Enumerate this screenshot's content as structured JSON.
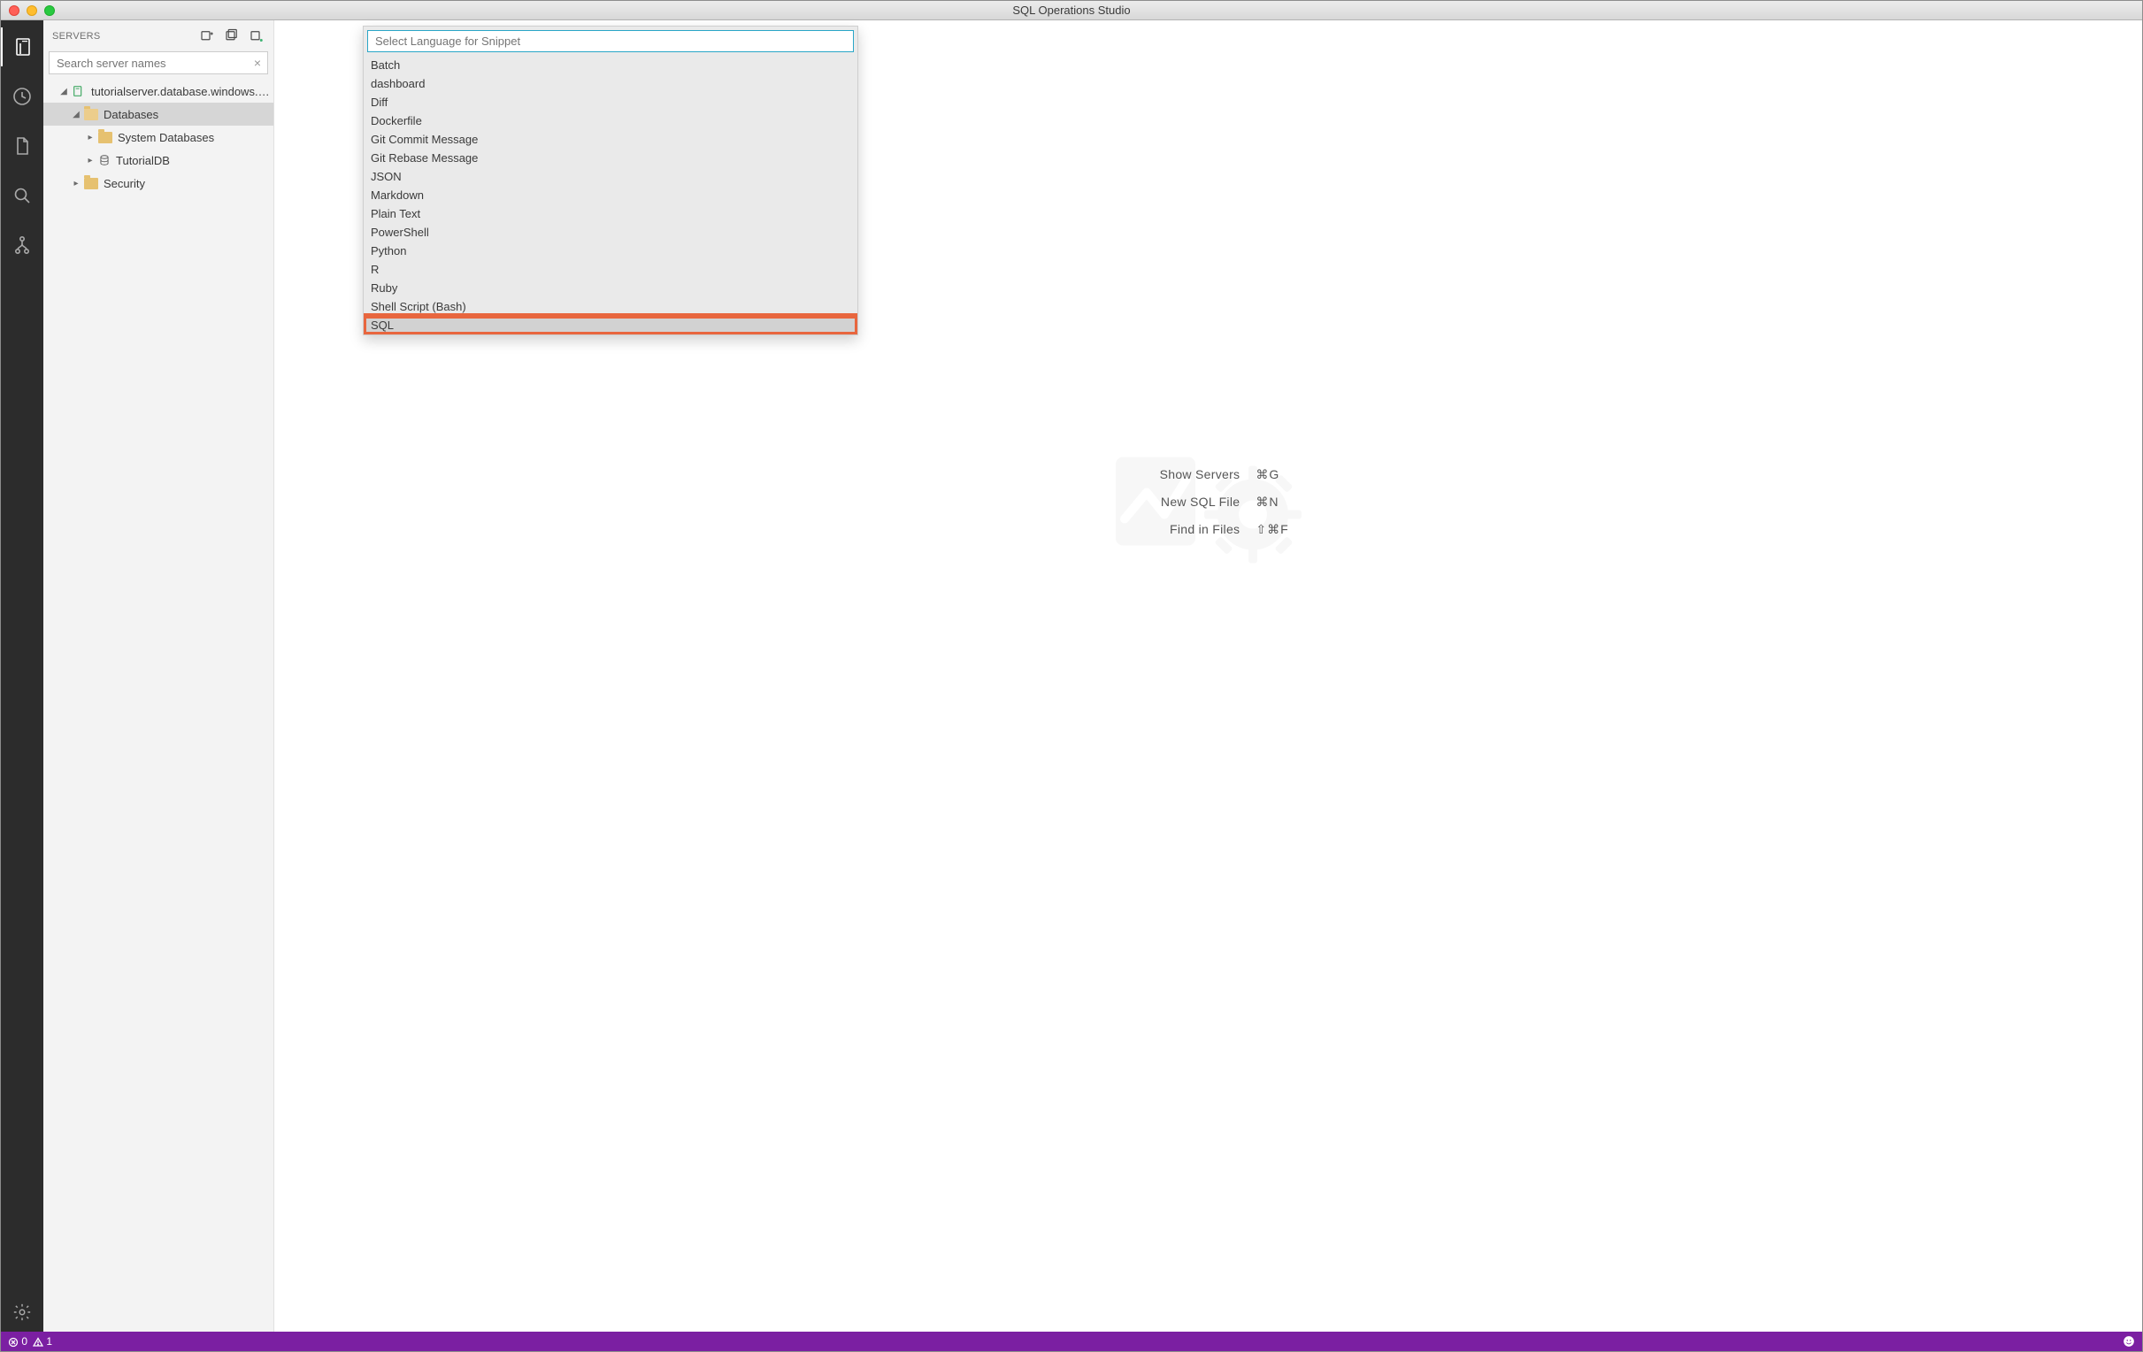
{
  "window": {
    "title": "SQL Operations Studio"
  },
  "sidebar": {
    "title": "SERVERS",
    "search_placeholder": "Search server names",
    "tree": {
      "server": "tutorialserver.database.windows.n...",
      "databases": "Databases",
      "system_databases": "System Databases",
      "tutorial_db": "TutorialDB",
      "security": "Security"
    }
  },
  "quickpick": {
    "placeholder": "Select Language for Snippet",
    "items": [
      "Batch",
      "dashboard",
      "Diff",
      "Dockerfile",
      "Git Commit Message",
      "Git Rebase Message",
      "JSON",
      "Markdown",
      "Plain Text",
      "PowerShell",
      "Python",
      "R",
      "Ruby",
      "Shell Script (Bash)",
      "SQL"
    ]
  },
  "shortcuts": [
    {
      "label": "Show Servers",
      "keys": "⌘G"
    },
    {
      "label": "New SQL File",
      "keys": "⌘N"
    },
    {
      "label": "Find in Files",
      "keys": "⇧⌘F"
    }
  ],
  "statusbar": {
    "errors": "0",
    "warnings": "1"
  }
}
